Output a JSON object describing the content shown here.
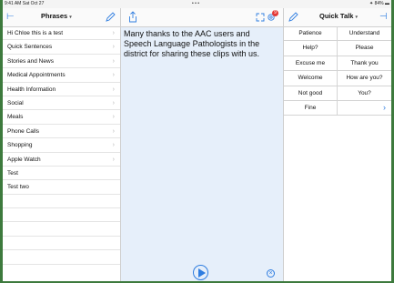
{
  "status": {
    "left": "9:41 AM  Sat Oct 27",
    "center": "• • •",
    "right": "✦ 84% ▬"
  },
  "left": {
    "title": "Phrases",
    "title_caret": "▾",
    "items": [
      "Hi Chloe this is a test",
      "Quick Sentences",
      "Stories and News",
      "Medical Appointments",
      "Health Information",
      "Social",
      "Meals",
      "Phone Calls",
      "Shopping",
      "Apple Watch",
      "Test",
      "Test two"
    ],
    "items_with_chevron": 10,
    "empty_rows": 5
  },
  "middle": {
    "text": "Many thanks to the AAC users and Speech Language Pathologists in the district for sharing these clips with us.",
    "badge": "9"
  },
  "right": {
    "title": "Quick Talk",
    "title_caret": "▾",
    "grid": [
      [
        "Patience",
        "Understand"
      ],
      [
        "Help?",
        "Please"
      ],
      [
        "Excuse me",
        "Thank you"
      ],
      [
        "Welcome",
        "How are you?"
      ],
      [
        "Not good",
        "You?"
      ],
      [
        "Fine",
        ""
      ]
    ]
  },
  "colors": {
    "accent": "#2f7de0",
    "editor_bg": "#e6effa",
    "badge": "#e53935",
    "frame": "#3d7a3d"
  }
}
